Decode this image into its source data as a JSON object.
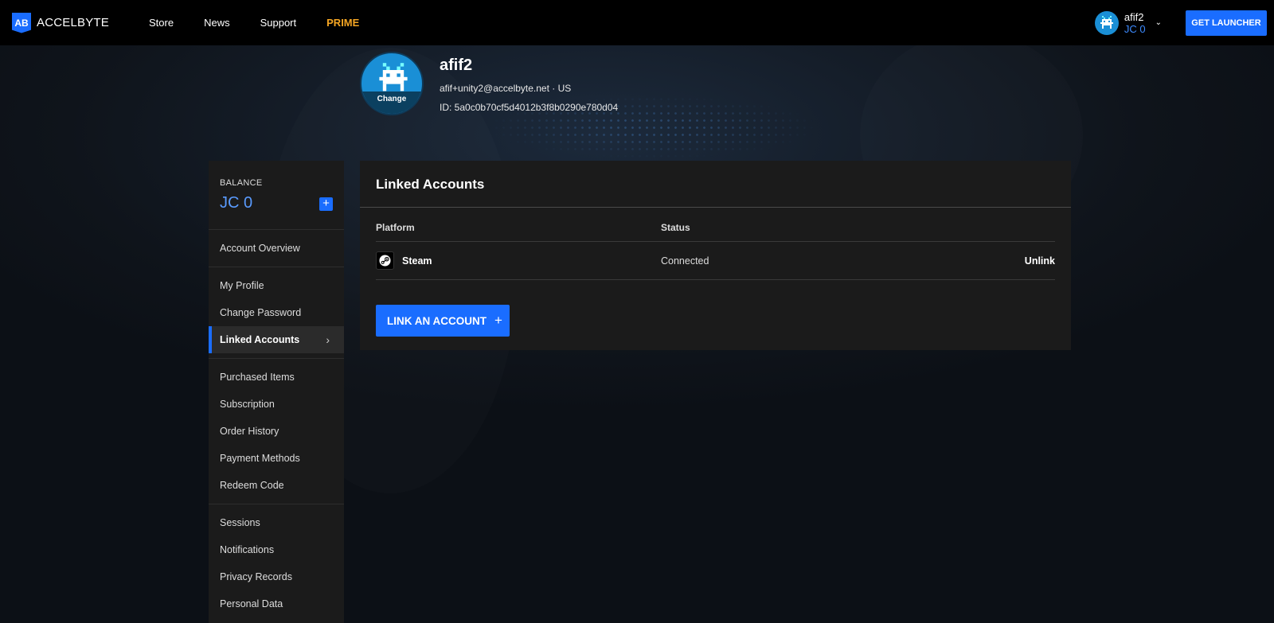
{
  "nav": {
    "logo_mark": "AB",
    "logo_text": "ACCELBYTE",
    "links": [
      "Store",
      "News",
      "Support",
      "PRIME"
    ],
    "user_name": "afif2",
    "user_balance": "JC 0",
    "launcher_label": "GET LAUNCHER"
  },
  "profile": {
    "name": "afif2",
    "email": "afif+unity2@accelbyte.net · US",
    "id": "ID: 5a0c0b70cf5d4012b3f8b0290e780d04",
    "avatar_change_label": "Change"
  },
  "sidebar": {
    "balance_label": "BALANCE",
    "balance_value": "JC 0",
    "add_label": "+",
    "groups": [
      [
        "Account Overview"
      ],
      [
        "My Profile",
        "Change Password",
        "Linked Accounts"
      ],
      [
        "Purchased Items",
        "Subscription",
        "Order History",
        "Payment Methods",
        "Redeem Code"
      ],
      [
        "Sessions",
        "Notifications",
        "Privacy Records",
        "Personal Data"
      ]
    ],
    "active_item": "Linked Accounts"
  },
  "main": {
    "title": "Linked Accounts",
    "columns": [
      "Platform",
      "Status"
    ],
    "rows": [
      {
        "platform": "Steam",
        "status": "Connected",
        "action": "Unlink"
      }
    ],
    "link_button_label": "LINK AN ACCOUNT",
    "link_button_icon": "+"
  },
  "colors": {
    "accent": "#1a6dff",
    "prime": "#f5a623",
    "balance": "#5a9bff"
  }
}
